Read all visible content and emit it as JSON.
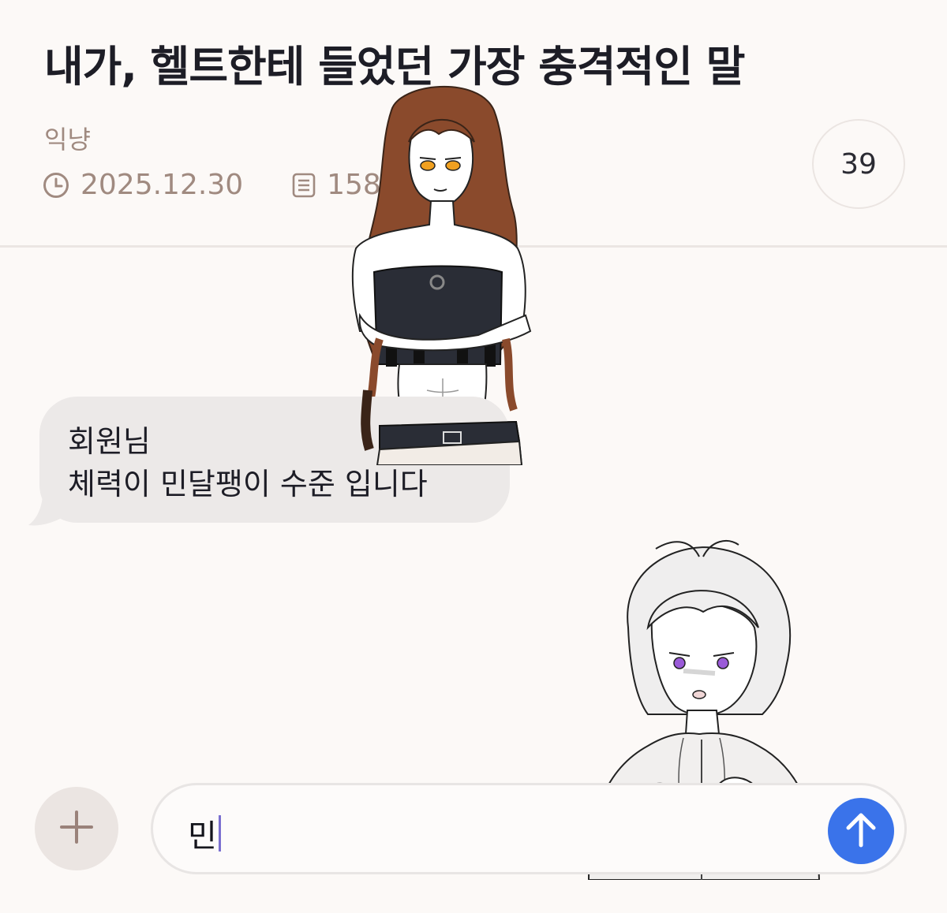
{
  "post": {
    "title": "내가, 헬트한테 들었던 가장 충격적인 말",
    "author": "익냥",
    "date": "2025.12.30",
    "views": "158",
    "comment_count": "39"
  },
  "icons": {
    "date": "clock-icon",
    "views": "document-icon",
    "add": "plus-icon",
    "send": "arrow-up-icon"
  },
  "message": {
    "lines": [
      "회원님",
      "체력이 민달팽이 수준 입니다"
    ]
  },
  "composer": {
    "value": "민"
  },
  "colors": {
    "background": "#fcf9f7",
    "muted_text": "#a08a80",
    "bubble": "#ece9e8",
    "send_button": "#3a73ea"
  }
}
